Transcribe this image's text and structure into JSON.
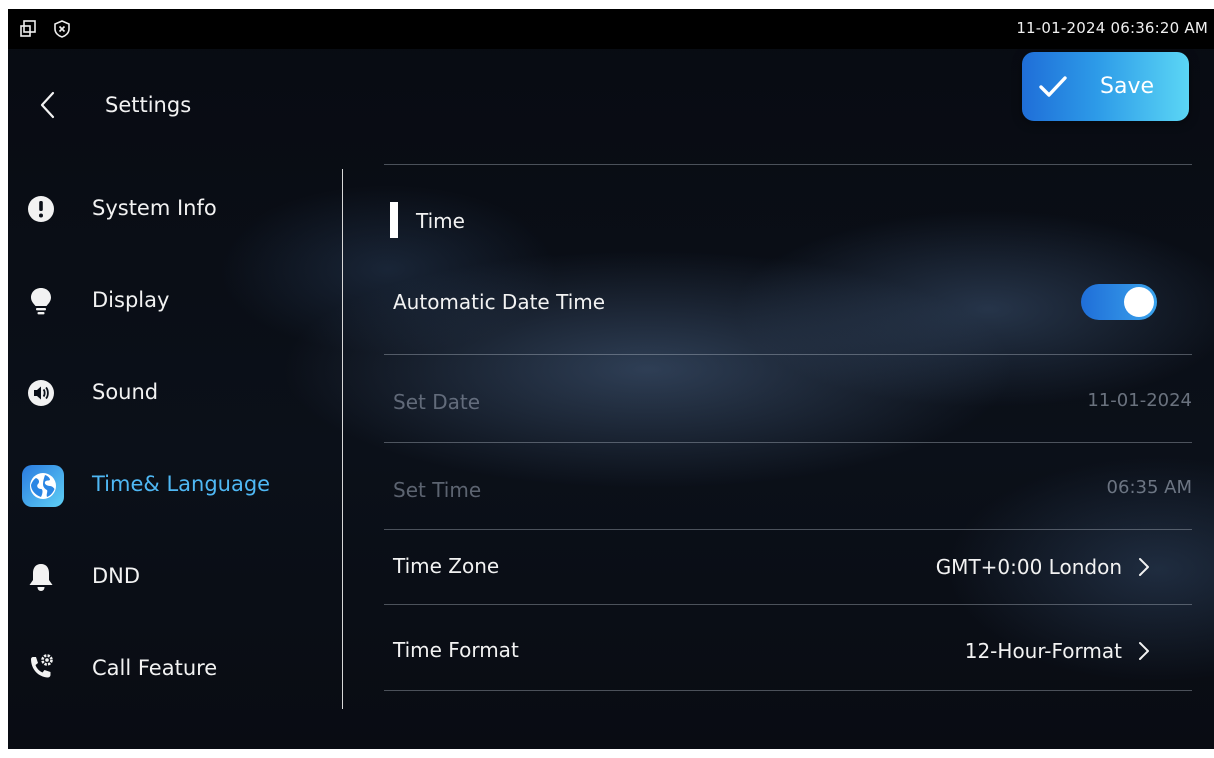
{
  "status_bar": {
    "datetime": "11-01-2024 06:36:20 AM",
    "icons": [
      "window-restore-icon",
      "shield-x-icon"
    ]
  },
  "header": {
    "title": "Settings",
    "back_icon": "chevron-left-icon",
    "save_label": "Save",
    "save_icon": "check-icon"
  },
  "sidebar": {
    "items": [
      {
        "label": "System Info",
        "icon": "info-exclamation-icon"
      },
      {
        "label": "Display",
        "icon": "lightbulb-icon"
      },
      {
        "label": "Sound",
        "icon": "speaker-icon"
      },
      {
        "label": "Time& Language",
        "icon": "globe-icon",
        "active": true
      },
      {
        "label": "DND",
        "icon": "bell-icon"
      },
      {
        "label": "Call Feature",
        "icon": "phone-settings-icon"
      }
    ]
  },
  "time_section": {
    "title": "Time",
    "automatic_date_time": {
      "label": "Automatic Date Time",
      "enabled": true
    },
    "set_date": {
      "label": "Set Date",
      "value": "11-01-2024"
    },
    "set_time": {
      "label": "Set Time",
      "value": "06:35 AM"
    },
    "time_zone": {
      "label": "Time Zone",
      "value": "GMT+0:00 London"
    },
    "time_format": {
      "label": "Time Format",
      "value": "12-Hour-Format"
    }
  },
  "colors": {
    "accent": "#4fb8f4",
    "save_gradient_start": "#1f6ed8",
    "save_gradient_end": "#5bd6f5"
  }
}
